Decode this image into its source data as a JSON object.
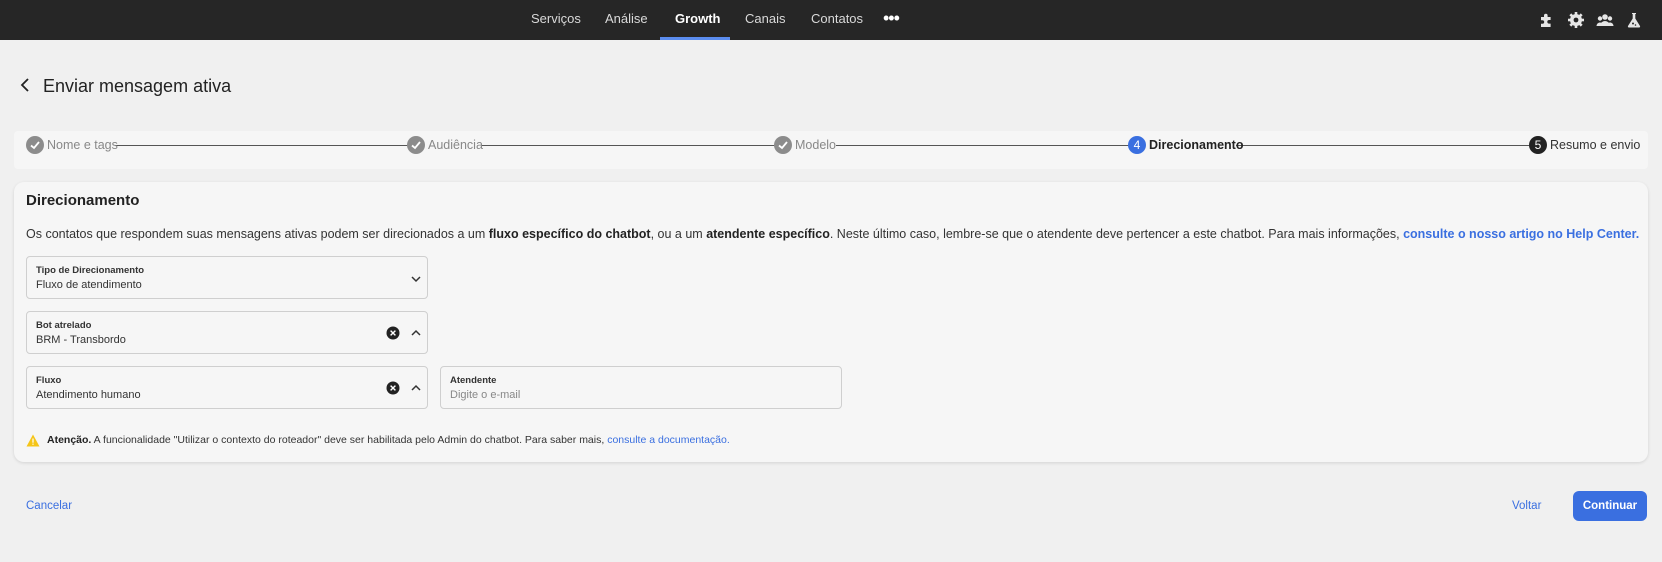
{
  "nav": {
    "items": [
      {
        "label": "Serviços"
      },
      {
        "label": "Análise"
      },
      {
        "label": "Growth",
        "active": true
      },
      {
        "label": "Canais"
      },
      {
        "label": "Contatos"
      }
    ],
    "more_icon": "more-horizontal-icon"
  },
  "top_icons": [
    "puzzle-icon",
    "gear-icon",
    "users-icon",
    "lab-flask-icon"
  ],
  "header": {
    "title": "Enviar mensagem ativa",
    "back_icon": "chevron-left-icon"
  },
  "stepper": {
    "steps": [
      {
        "number": "1",
        "label": "Nome e tags",
        "state": "done"
      },
      {
        "number": "2",
        "label": "Audiência",
        "state": "done"
      },
      {
        "number": "3",
        "label": "Modelo",
        "state": "done"
      },
      {
        "number": "4",
        "label": "Direcionamento",
        "state": "current"
      },
      {
        "number": "5",
        "label": "Resumo e envio",
        "state": "future"
      }
    ]
  },
  "card": {
    "title": "Direcionamento",
    "description": {
      "part1": "Os contatos que respondem suas mensagens ativas podem ser direcionados a um ",
      "bold1": "fluxo específico do chatbot",
      "part2": ", ou a um ",
      "bold2": "atendente específico",
      "part3": ". Neste último caso, lembre-se que o atendente deve pertencer a este chatbot. Para mais informações, ",
      "link": "consulte o nosso artigo no Help Center."
    },
    "fields": {
      "tipo": {
        "label": "Tipo de Direcionamento",
        "value": "Fluxo de atendimento"
      },
      "bot": {
        "label": "Bot atrelado",
        "value": "BRM - Transbordo"
      },
      "fluxo": {
        "label": "Fluxo",
        "value": "Atendimento humano"
      },
      "atendente": {
        "label": "Atendente",
        "placeholder": "Digite o e-mail"
      }
    },
    "warning": {
      "bold": "Atenção.",
      "text": " A funcionalidade \"Utilizar o contexto do roteador\" deve ser habilitada pelo Admin do chatbot. Para saber mais, ",
      "link": "consulte a documentação."
    }
  },
  "footer": {
    "cancel": "Cancelar",
    "back": "Voltar",
    "continue": "Continuar"
  },
  "colors": {
    "topbar": "#262626",
    "accent": "#3a6fe0",
    "background": "#f0f0f0",
    "warning": "#f5c518"
  }
}
